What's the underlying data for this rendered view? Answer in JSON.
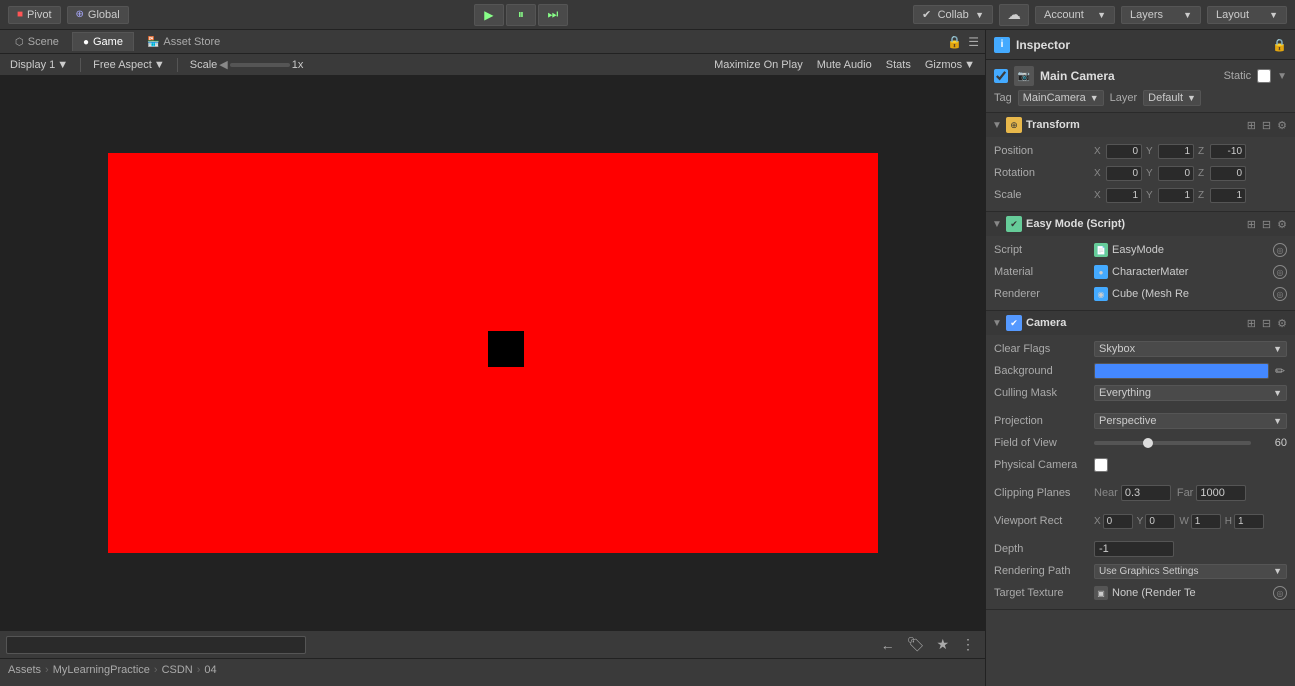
{
  "toolbar": {
    "pivot_label": "Pivot",
    "global_label": "Global",
    "collab_label": "Collab",
    "account_label": "Account",
    "layers_label": "Layers",
    "layout_label": "Layout"
  },
  "tabs": {
    "scene_label": "Scene",
    "game_label": "Game",
    "asset_store_label": "Asset Store"
  },
  "game_toolbar": {
    "display_label": "Display 1",
    "aspect_label": "Free Aspect",
    "scale_label": "Scale",
    "scale_value": "1x",
    "maximize_label": "Maximize On Play",
    "mute_label": "Mute Audio",
    "stats_label": "Stats",
    "gizmos_label": "Gizmos"
  },
  "inspector": {
    "title": "Inspector",
    "object_name": "Main Camera",
    "object_tag": "MainCamera",
    "object_layer": "Default",
    "static_label": "Static",
    "transform": {
      "name": "Transform",
      "position": {
        "x": "0",
        "y": "1",
        "z": "-10"
      },
      "rotation": {
        "x": "0",
        "y": "0",
        "z": "0"
      },
      "scale": {
        "x": "1",
        "y": "1",
        "z": "1"
      }
    },
    "easy_mode": {
      "name": "Easy Mode (Script)",
      "script": "EasyMode",
      "material": "CharacterMater",
      "renderer": "Cube (Mesh Re"
    },
    "camera": {
      "name": "Camera",
      "clear_flags_label": "Clear Flags",
      "clear_flags_value": "Skybox",
      "background_label": "Background",
      "culling_mask_label": "Culling Mask",
      "culling_mask_value": "Everything",
      "projection_label": "Projection",
      "projection_value": "Perspective",
      "fov_label": "Field of View",
      "fov_value": "60",
      "physical_camera_label": "Physical Camera",
      "clipping_planes_label": "Clipping Planes",
      "near_label": "Near",
      "near_value": "0.3",
      "far_label": "Far",
      "far_value": "1000",
      "viewport_rect_label": "Viewport Rect",
      "vr_x": "0",
      "vr_y": "0",
      "vr_w": "1",
      "vr_h": "1",
      "depth_label": "Depth",
      "depth_value": "-1",
      "rendering_path_label": "Rendering Path",
      "rendering_path_value": "Use Graphics Settings",
      "target_texture_label": "Target Texture",
      "target_texture_value": "None (Render Te"
    }
  },
  "bottom": {
    "search_placeholder": "",
    "breadcrumb": [
      "Assets",
      "MyLearningPractice",
      "CSDN",
      "04"
    ]
  }
}
